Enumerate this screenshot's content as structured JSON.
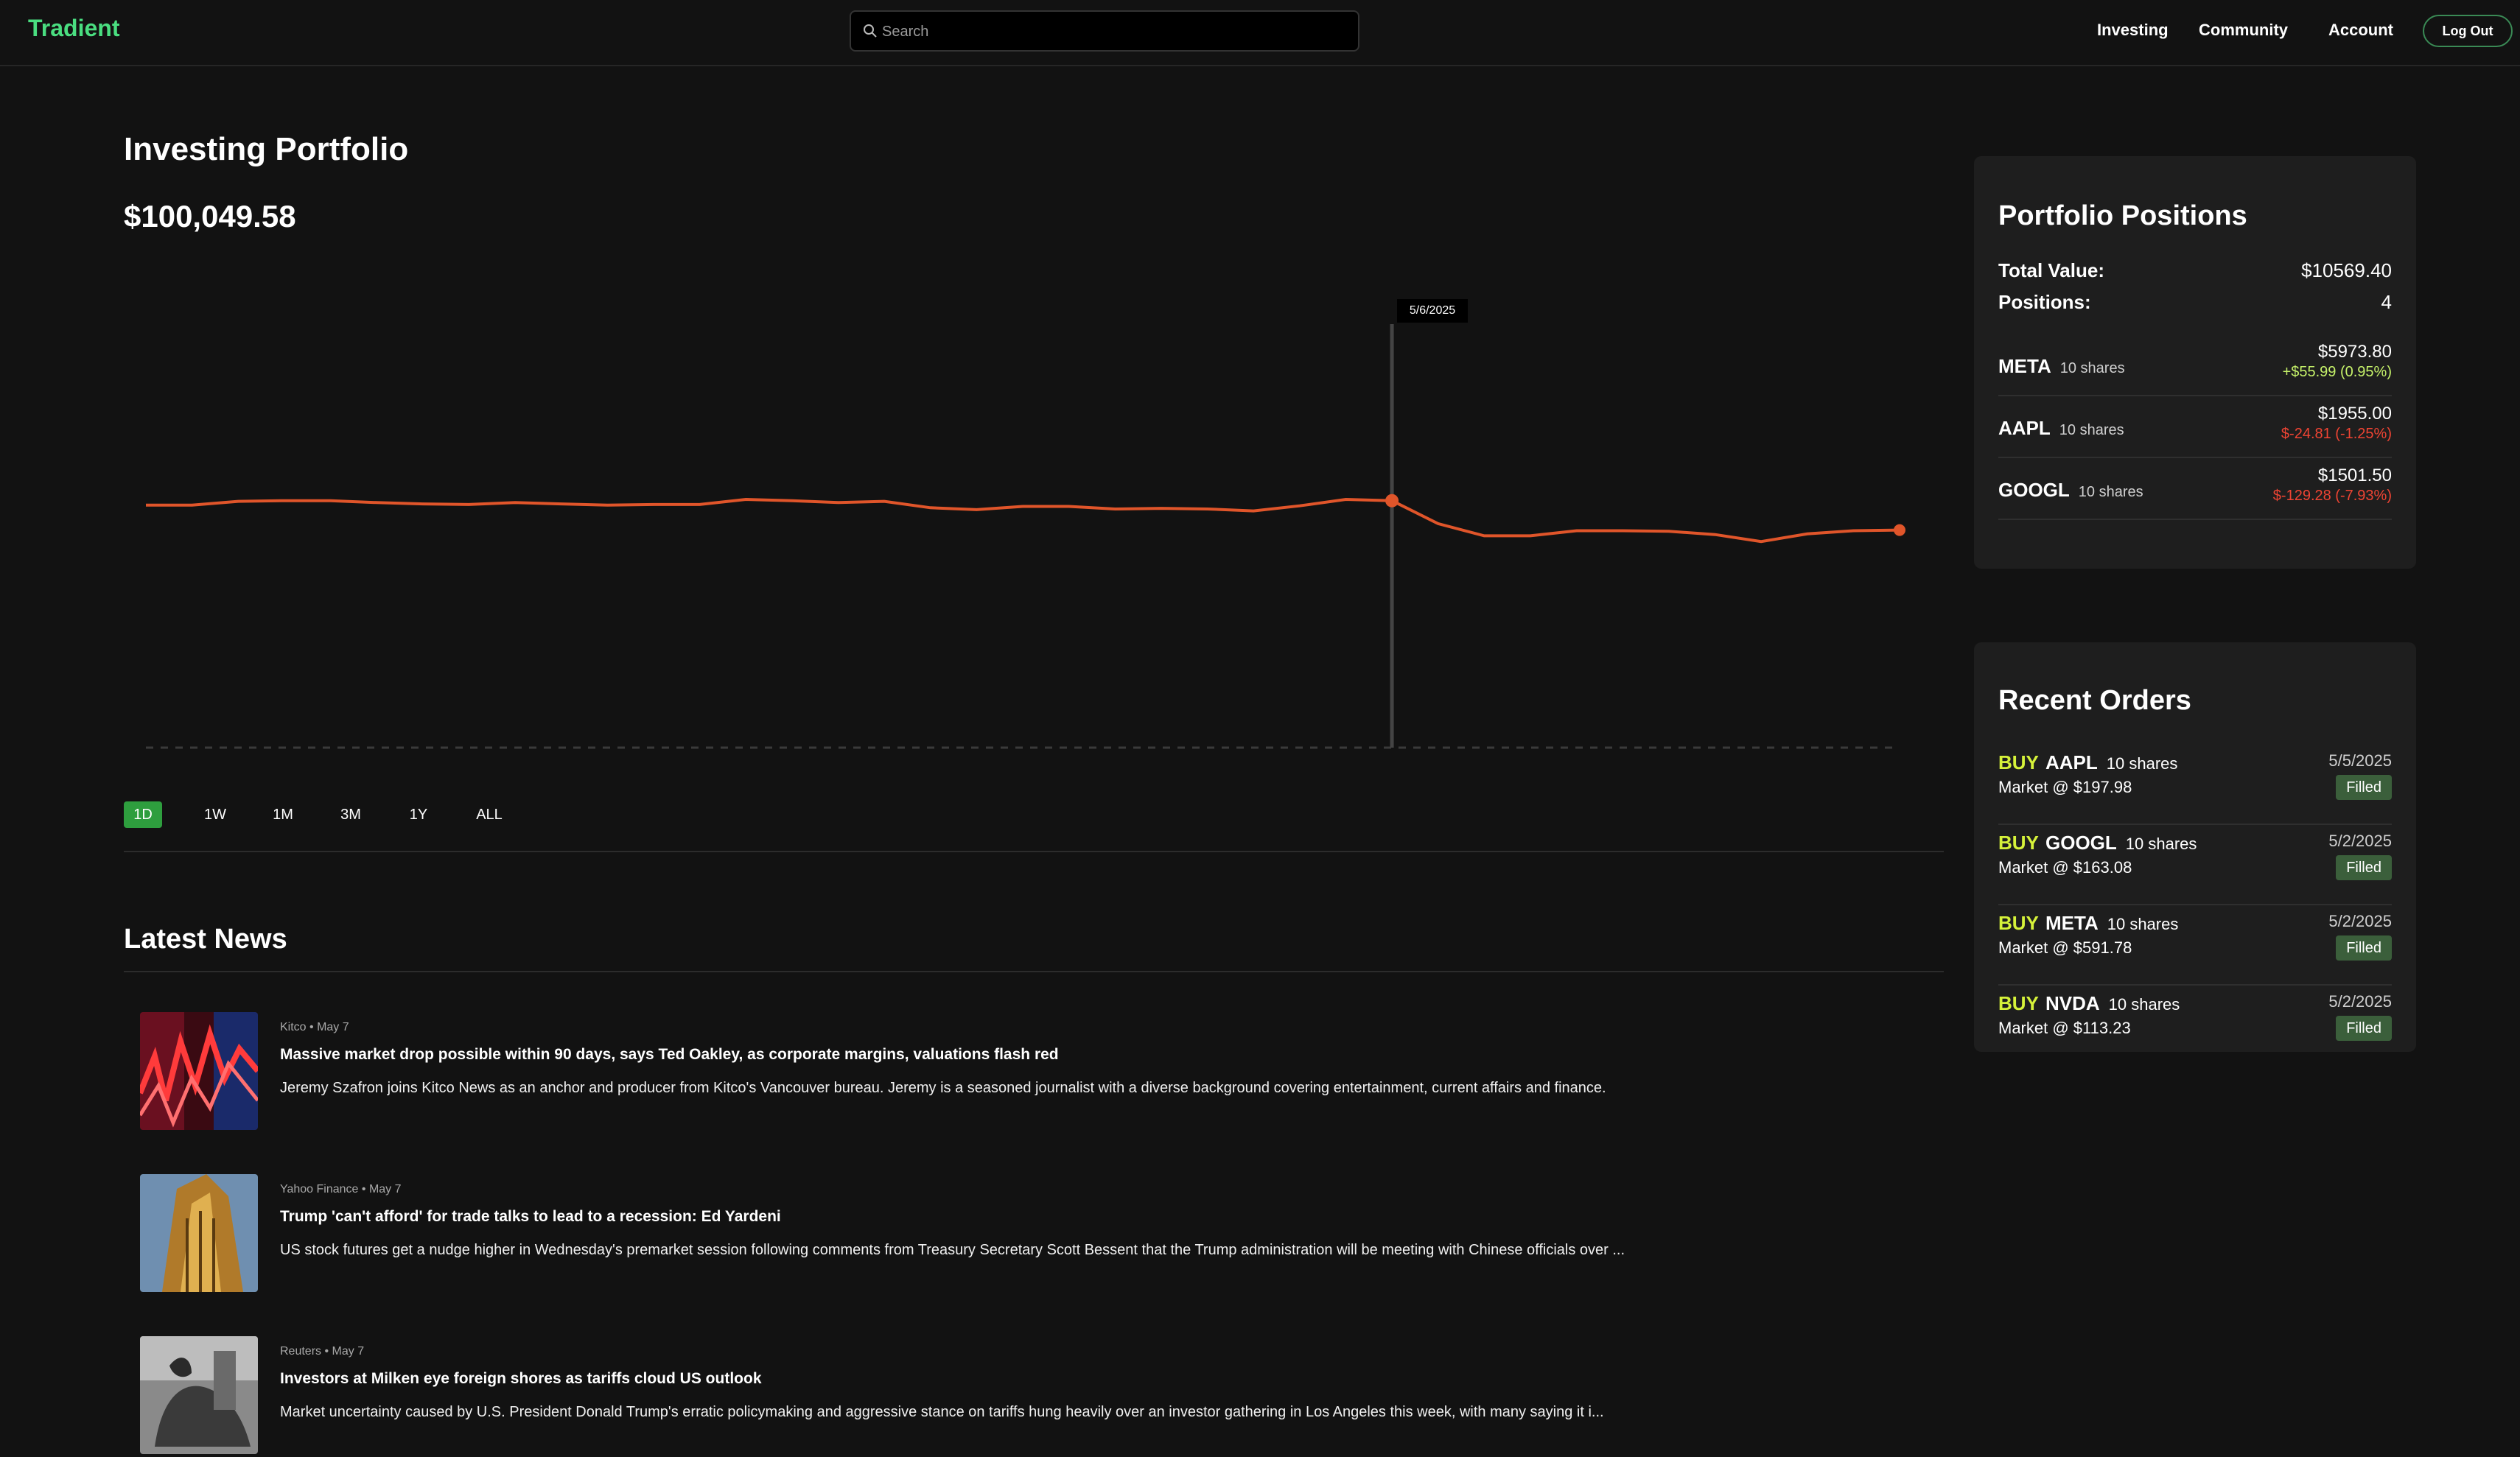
{
  "nav": {
    "brand": "Tradient",
    "search_placeholder": "Search",
    "links": [
      "Investing",
      "Community",
      "Account"
    ],
    "logout": "Log Out"
  },
  "portfolio": {
    "title": "Investing Portfolio",
    "value": "$100,049.58",
    "tooltip_date": "5/6/2025",
    "ranges": [
      "1D",
      "1W",
      "1M",
      "3M",
      "1Y",
      "ALL"
    ],
    "active_range": "1D"
  },
  "chart_data": {
    "type": "line",
    "line_color": "#e0552a",
    "highlighted_point_index": 27,
    "series": [
      {
        "values": [
          100051,
          100051,
          100057,
          100058,
          100058,
          100055,
          100053,
          100052,
          100055,
          100053,
          100051,
          100052,
          100052,
          100060,
          100058,
          100055,
          100057,
          100047,
          100044,
          100049,
          100049,
          100045,
          100046,
          100045,
          100042,
          100050,
          100060,
          100058,
          100022,
          100003,
          100003,
          100011,
          100011,
          100010,
          100005,
          99994,
          100006,
          100011,
          100012
        ]
      }
    ],
    "grid": false
  },
  "news": {
    "title": "Latest News",
    "items": [
      {
        "meta": "Kitco • May 7",
        "headline": "Massive market drop possible within 90 days, says Ted Oakley, as corporate margins, valuations flash red",
        "summary": "Jeremy Szafron joins Kitco News as an anchor and producer from Kitco's Vancouver bureau.  Jeremy is a seasoned journalist with a diverse background covering entertainment, current affairs and finance."
      },
      {
        "meta": "Yahoo Finance • May 7",
        "headline": "Trump 'can't afford' for trade talks to lead to a recession: Ed Yardeni",
        "summary": "US stock futures get a nudge higher in Wednesday's premarket session following comments from Treasury Secretary Scott Bessent that the Trump administration will be meeting with Chinese officials over ..."
      },
      {
        "meta": "Reuters • May 7",
        "headline": "Investors at Milken eye foreign shores as tariffs cloud US outlook",
        "summary": "Market uncertainty caused by U.S. President Donald Trump's erratic policymaking and aggressive stance on tariffs hung heavily over an investor gathering in Los Angeles this week, with many saying it i..."
      }
    ]
  },
  "positions": {
    "title": "Portfolio Positions",
    "total_label": "Total Value:",
    "total_value": "$10569.40",
    "count_label": "Positions:",
    "count_value": "4",
    "items": [
      {
        "ticker": "META",
        "shares": "10 shares",
        "value": "$5973.80",
        "change": "+$55.99 (0.95%)",
        "direction": "up"
      },
      {
        "ticker": "AAPL",
        "shares": "10 shares",
        "value": "$1955.00",
        "change": "$-24.81 (-1.25%)",
        "direction": "down"
      },
      {
        "ticker": "GOOGL",
        "shares": "10 shares",
        "value": "$1501.50",
        "change": "$-129.28 (-7.93%)",
        "direction": "down"
      }
    ]
  },
  "orders": {
    "title": "Recent Orders",
    "items": [
      {
        "side": "BUY",
        "ticker": "AAPL",
        "shares": "10 shares",
        "desc": "Market @ $197.98",
        "date": "5/5/2025",
        "status": "Filled"
      },
      {
        "side": "BUY",
        "ticker": "GOOGL",
        "shares": "10 shares",
        "desc": "Market @ $163.08",
        "date": "5/2/2025",
        "status": "Filled"
      },
      {
        "side": "BUY",
        "ticker": "META",
        "shares": "10 shares",
        "desc": "Market @ $591.78",
        "date": "5/2/2025",
        "status": "Filled"
      },
      {
        "side": "BUY",
        "ticker": "NVDA",
        "shares": "10 shares",
        "desc": "Market @ $113.23",
        "date": "5/2/2025",
        "status": "Filled"
      }
    ]
  }
}
